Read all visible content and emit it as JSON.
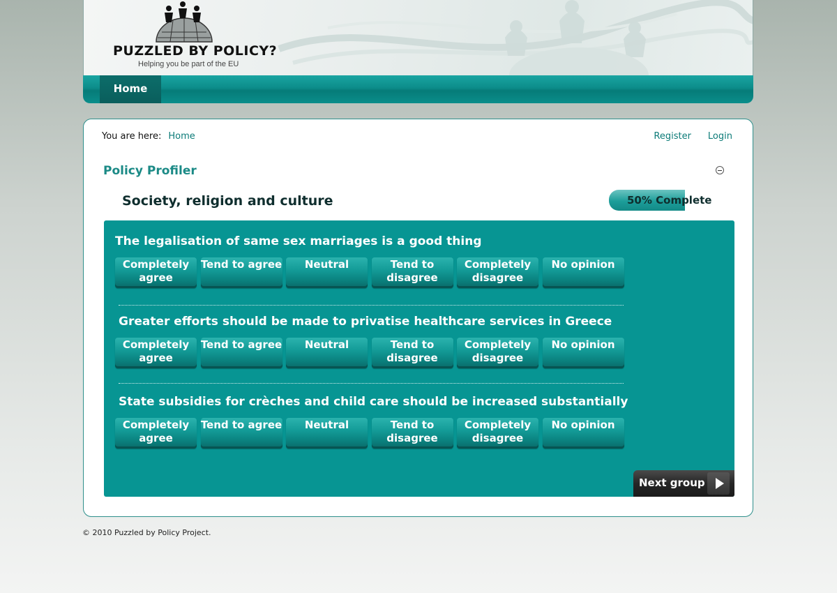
{
  "header": {
    "logo_title": "PUZZLED BY POLICY?",
    "logo_tagline": "Helping you be part of the EU"
  },
  "nav": {
    "home_label": "Home"
  },
  "breadcrumb": {
    "prefix": "You are here:",
    "home": "Home"
  },
  "toplinks": {
    "register": "Register",
    "login": "Login"
  },
  "module": {
    "title": "Policy Profiler"
  },
  "group": {
    "title": "Society, religion and culture",
    "progress_percent": 50,
    "progress_label": "50% Complete"
  },
  "answer_options": [
    "Completely agree",
    "Tend to agree",
    "Neutral",
    "Tend to disagree",
    "Completely disagree",
    "No opinion"
  ],
  "questions": [
    {
      "text": "The legalisation of same sex marriages is a good thing"
    },
    {
      "text": "Greater efforts should be made to privatise healthcare services in Greece"
    },
    {
      "text": "State subsidies for crèches and child care should be increased substantially"
    }
  ],
  "next_button": {
    "label": "Next group",
    "icon": "play-arrow-icon"
  },
  "footer": {
    "copyright": "© 2010 Puzzled by Policy Project."
  },
  "colors": {
    "teal": "#079593",
    "link": "#0c7b78",
    "title": "#1b8a86",
    "dark_button": "#262626"
  }
}
